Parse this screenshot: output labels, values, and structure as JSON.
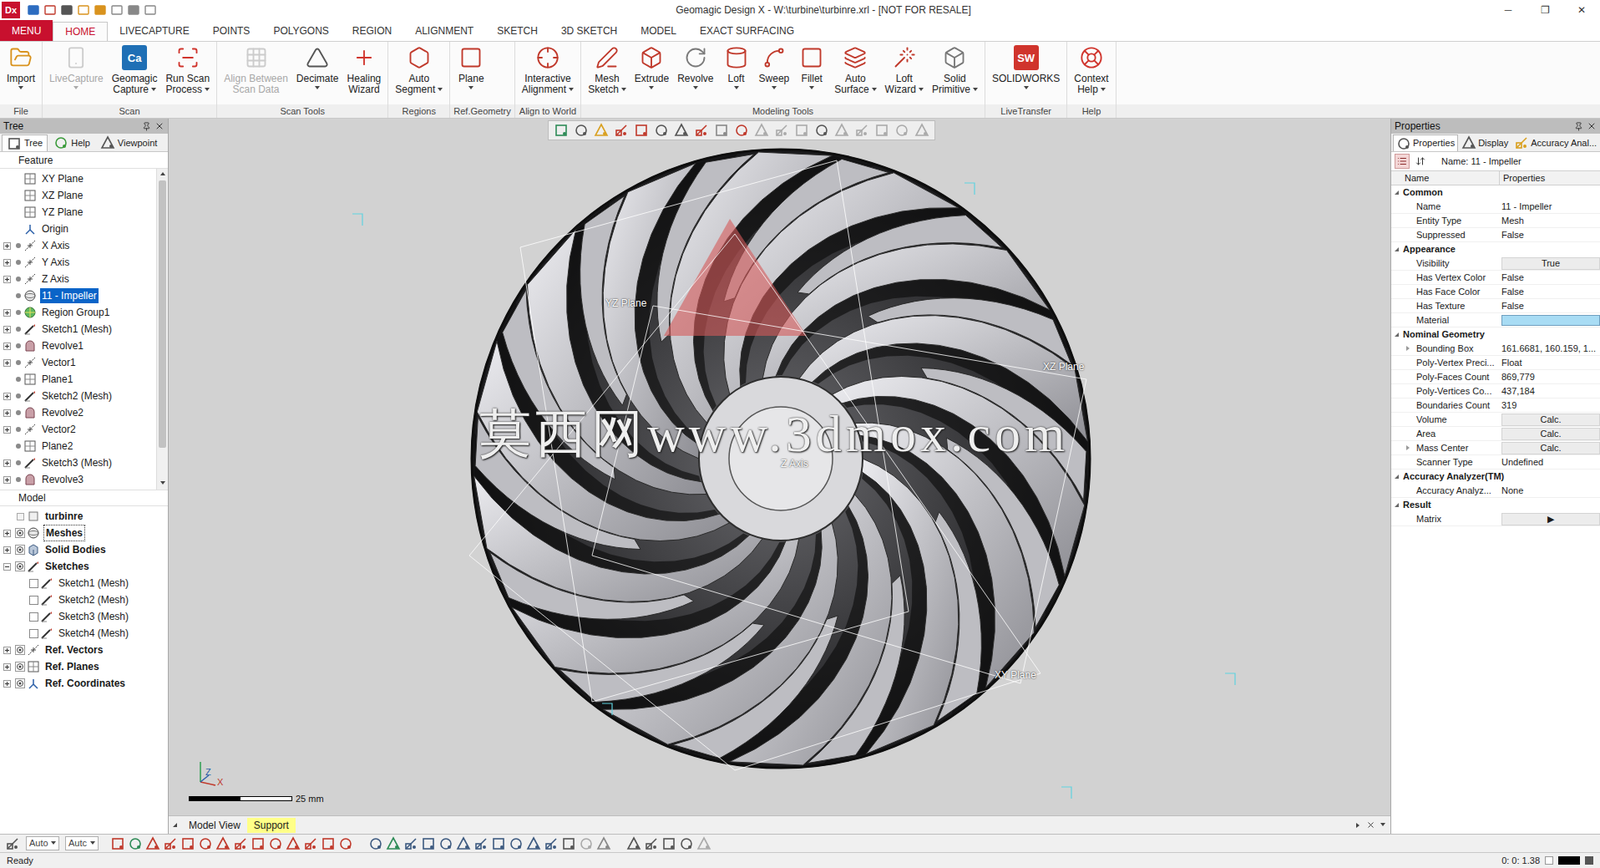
{
  "window": {
    "app_logo": "Dx",
    "title": "Geomagic Design X - W:\\turbine\\turbinre.xrl - [NOT FOR RESALE]",
    "controls": [
      "─",
      "❐",
      "✕"
    ]
  },
  "ribbon_tabs": [
    {
      "label": "MENU",
      "selected": false,
      "kind": "menu"
    },
    {
      "label": "HOME",
      "selected": true,
      "kind": "tab"
    },
    {
      "label": "LIVECAPTURE",
      "selected": false,
      "kind": "tab"
    },
    {
      "label": "POINTS",
      "selected": false,
      "kind": "tab"
    },
    {
      "label": "POLYGONS",
      "selected": false,
      "kind": "tab"
    },
    {
      "label": "REGION",
      "selected": false,
      "kind": "tab"
    },
    {
      "label": "ALIGNMENT",
      "selected": false,
      "kind": "tab"
    },
    {
      "label": "SKETCH",
      "selected": false,
      "kind": "tab"
    },
    {
      "label": "3D SKETCH",
      "selected": false,
      "kind": "tab"
    },
    {
      "label": "MODEL",
      "selected": false,
      "kind": "tab"
    },
    {
      "label": "EXACT SURFACING",
      "selected": false,
      "kind": "tab"
    }
  ],
  "ribbon_groups": [
    {
      "label": "File",
      "buttons": [
        {
          "lines": [
            "Import"
          ],
          "dropdown": true,
          "disabled": false
        }
      ]
    },
    {
      "label": "Scan",
      "buttons": [
        {
          "lines": [
            "LiveCapture"
          ],
          "dropdown": true,
          "disabled": true
        },
        {
          "lines": [
            "Geomagic",
            "Capture"
          ],
          "dropdown": true,
          "disabled": false,
          "logo": "Ca"
        },
        {
          "lines": [
            "Run Scan",
            "Process"
          ],
          "dropdown": true,
          "disabled": false
        }
      ]
    },
    {
      "label": "Scan Tools",
      "buttons": [
        {
          "lines": [
            "Align Between",
            "Scan Data"
          ],
          "dropdown": false,
          "disabled": true
        },
        {
          "lines": [
            "Decimate"
          ],
          "dropdown": true,
          "disabled": false
        },
        {
          "lines": [
            "Healing",
            "Wizard"
          ],
          "dropdown": false,
          "disabled": false
        }
      ]
    },
    {
      "label": "Regions",
      "buttons": [
        {
          "lines": [
            "Auto",
            "Segment"
          ],
          "dropdown": true,
          "disabled": false
        }
      ]
    },
    {
      "label": "Ref.Geometry",
      "buttons": [
        {
          "lines": [
            "Plane"
          ],
          "dropdown": true,
          "disabled": false
        }
      ]
    },
    {
      "label": "Align to World",
      "buttons": [
        {
          "lines": [
            "Interactive",
            "Alignment"
          ],
          "dropdown": true,
          "disabled": false
        }
      ]
    },
    {
      "label": "Modeling Tools",
      "buttons": [
        {
          "lines": [
            "Mesh",
            "Sketch"
          ],
          "dropdown": true,
          "disabled": false
        },
        {
          "lines": [
            "Extrude"
          ],
          "dropdown": true,
          "disabled": false
        },
        {
          "lines": [
            "Revolve"
          ],
          "dropdown": true,
          "disabled": false
        },
        {
          "lines": [
            "Loft"
          ],
          "dropdown": true,
          "disabled": false
        },
        {
          "lines": [
            "Sweep"
          ],
          "dropdown": true,
          "disabled": false
        },
        {
          "lines": [
            "Fillet"
          ],
          "dropdown": true,
          "disabled": false
        },
        {
          "lines": [
            "Auto",
            "Surface"
          ],
          "dropdown": true,
          "disabled": false
        },
        {
          "lines": [
            "Loft",
            "Wizard"
          ],
          "dropdown": true,
          "disabled": false
        },
        {
          "lines": [
            "Solid",
            "Primitive"
          ],
          "dropdown": true,
          "disabled": false
        }
      ]
    },
    {
      "label": "LiveTransfer",
      "buttons": [
        {
          "lines": [
            "SOLIDWORKS"
          ],
          "dropdown": true,
          "disabled": false,
          "logo": "SW"
        }
      ]
    },
    {
      "label": "Help",
      "buttons": [
        {
          "lines": [
            "Context",
            "Help"
          ],
          "dropdown": true,
          "disabled": false
        }
      ]
    }
  ],
  "tree_panel": {
    "title": "Tree",
    "tabs": [
      {
        "label": "Tree",
        "selected": true
      },
      {
        "label": "Help",
        "selected": false
      },
      {
        "label": "Viewpoint",
        "selected": false
      }
    ],
    "feature_label": "Feature",
    "scroll_level": 0.9,
    "features": [
      {
        "label": "XY Plane",
        "kind": "plane",
        "expandable": false,
        "expanded": false,
        "dot": false,
        "selected": false
      },
      {
        "label": "XZ Plane",
        "kind": "plane",
        "expandable": false,
        "expanded": false,
        "dot": false,
        "selected": false
      },
      {
        "label": "YZ Plane",
        "kind": "plane",
        "expandable": false,
        "expanded": false,
        "dot": false,
        "selected": false
      },
      {
        "label": "Origin",
        "kind": "origin",
        "expandable": false,
        "expanded": false,
        "dot": false,
        "selected": false
      },
      {
        "label": "X Axis",
        "kind": "axis",
        "expandable": true,
        "expanded": false,
        "dot": true,
        "selected": false
      },
      {
        "label": "Y Axis",
        "kind": "axis",
        "expandable": true,
        "expanded": false,
        "dot": true,
        "selected": false
      },
      {
        "label": "Z Axis",
        "kind": "axis",
        "expandable": true,
        "expanded": false,
        "dot": true,
        "selected": false
      },
      {
        "label": "11 - Impeller",
        "kind": "mesh",
        "expandable": false,
        "expanded": false,
        "dot": true,
        "selected": true
      },
      {
        "label": "Region Group1",
        "kind": "region",
        "expandable": true,
        "expanded": false,
        "dot": true,
        "selected": false
      },
      {
        "label": "Sketch1 (Mesh)",
        "kind": "sketch",
        "expandable": true,
        "expanded": false,
        "dot": true,
        "selected": false
      },
      {
        "label": "Revolve1",
        "kind": "revolve",
        "expandable": true,
        "expanded": false,
        "dot": true,
        "selected": false
      },
      {
        "label": "Vector1",
        "kind": "axis",
        "expandable": true,
        "expanded": false,
        "dot": true,
        "selected": false
      },
      {
        "label": "Plane1",
        "kind": "plane",
        "expandable": false,
        "expanded": false,
        "dot": true,
        "selected": false
      },
      {
        "label": "Sketch2 (Mesh)",
        "kind": "sketch",
        "expandable": true,
        "expanded": false,
        "dot": true,
        "selected": false
      },
      {
        "label": "Revolve2",
        "kind": "revolve",
        "expandable": true,
        "expanded": false,
        "dot": true,
        "selected": false
      },
      {
        "label": "Vector2",
        "kind": "axis",
        "expandable": true,
        "expanded": false,
        "dot": true,
        "selected": false
      },
      {
        "label": "Plane2",
        "kind": "plane",
        "expandable": false,
        "expanded": false,
        "dot": true,
        "selected": false
      },
      {
        "label": "Sketch3 (Mesh)",
        "kind": "sketch",
        "expandable": true,
        "expanded": false,
        "dot": true,
        "selected": false
      },
      {
        "label": "Revolve3",
        "kind": "revolve",
        "expandable": true,
        "expanded": false,
        "dot": true,
        "selected": false
      }
    ],
    "model_label": "Model",
    "model": [
      {
        "label": "turbinre",
        "kind": "root",
        "depth": 0,
        "expandable": false,
        "expanded": false,
        "control": "none",
        "checked": false,
        "bold": true,
        "focused": false
      },
      {
        "label": "Meshes",
        "kind": "mesh",
        "depth": 0,
        "expandable": true,
        "expanded": false,
        "control": "eye",
        "checked": true,
        "bold": true,
        "focused": true
      },
      {
        "label": "Solid Bodies",
        "kind": "solid",
        "depth": 0,
        "expandable": true,
        "expanded": false,
        "control": "eye",
        "checked": true,
        "bold": true,
        "focused": false
      },
      {
        "label": "Sketches",
        "kind": "sketch",
        "depth": 0,
        "expandable": true,
        "expanded": true,
        "control": "eye",
        "checked": true,
        "bold": true,
        "focused": false
      },
      {
        "label": "Sketch1 (Mesh)",
        "kind": "sketch",
        "depth": 1,
        "expandable": false,
        "expanded": false,
        "control": "checkbox",
        "checked": false,
        "bold": false,
        "focused": false
      },
      {
        "label": "Sketch2 (Mesh)",
        "kind": "sketch",
        "depth": 1,
        "expandable": false,
        "expanded": false,
        "control": "checkbox",
        "checked": false,
        "bold": false,
        "focused": false
      },
      {
        "label": "Sketch3 (Mesh)",
        "kind": "sketch",
        "depth": 1,
        "expandable": false,
        "expanded": false,
        "control": "checkbox",
        "checked": false,
        "bold": false,
        "focused": false
      },
      {
        "label": "Sketch4 (Mesh)",
        "kind": "sketch",
        "depth": 1,
        "expandable": false,
        "expanded": false,
        "control": "checkbox",
        "checked": false,
        "bold": false,
        "focused": false
      },
      {
        "label": "Ref. Vectors",
        "kind": "axis",
        "depth": 0,
        "expandable": true,
        "expanded": false,
        "control": "eye",
        "checked": true,
        "bold": true,
        "focused": false
      },
      {
        "label": "Ref. Planes",
        "kind": "plane",
        "depth": 0,
        "expandable": true,
        "expanded": false,
        "control": "eye",
        "checked": true,
        "bold": true,
        "focused": false
      },
      {
        "label": "Ref. Coordinates",
        "kind": "origin",
        "depth": 0,
        "expandable": true,
        "expanded": false,
        "control": "eye",
        "checked": true,
        "bold": true,
        "focused": false
      }
    ]
  },
  "viewport": {
    "labels": [
      "YZ Plane",
      "XZ Plane",
      "XY Plane",
      "Z Axis"
    ],
    "watermark": "莫西网www.3dmox.com",
    "scale": "25 mm",
    "triad": [
      "Z",
      "X"
    ]
  },
  "view_tabs": [
    {
      "label": "Model View",
      "selected": false
    },
    {
      "label": "Support",
      "selected": true
    }
  ],
  "properties_panel": {
    "title": "Properties",
    "tabs": [
      {
        "label": "Properties",
        "selected": true
      },
      {
        "label": "Display",
        "selected": false
      },
      {
        "label": "Accuracy Anal...",
        "selected": false
      }
    ],
    "name_line": "Name: 11 - Impeller",
    "columns": [
      "Name",
      "Properties"
    ],
    "sections": [
      {
        "label": "Common",
        "expanded": true,
        "rows": [
          {
            "name": "Name",
            "value": "11 - Impeller",
            "kind": "text",
            "expandable": false
          },
          {
            "name": "Entity Type",
            "value": "Mesh",
            "kind": "text",
            "expandable": false
          },
          {
            "name": "Suppressed",
            "value": "False",
            "kind": "text",
            "expandable": false
          }
        ]
      },
      {
        "label": "Appearance",
        "expanded": true,
        "rows": [
          {
            "name": "Visibility",
            "value": "True",
            "kind": "button",
            "expandable": false
          },
          {
            "name": "Has Vertex Color",
            "value": "False",
            "kind": "text",
            "expandable": false
          },
          {
            "name": "Has Face Color",
            "value": "False",
            "kind": "text",
            "expandable": false
          },
          {
            "name": "Has Texture",
            "value": "False",
            "kind": "text",
            "expandable": false
          },
          {
            "name": "Material",
            "value": "",
            "kind": "swatch",
            "color": "#a8dcf4",
            "expandable": false
          }
        ]
      },
      {
        "label": "Nominal Geometry",
        "expanded": true,
        "rows": [
          {
            "name": "Bounding Box",
            "value": "161.6681, 160.159, 1...",
            "kind": "text",
            "expandable": true
          },
          {
            "name": "Poly-Vertex Preci...",
            "value": "Float",
            "kind": "text",
            "expandable": false
          },
          {
            "name": "Poly-Faces Count",
            "value": "869,779",
            "kind": "text",
            "expandable": false
          },
          {
            "name": "Poly-Vertices Co...",
            "value": "437,184",
            "kind": "text",
            "expandable": false
          },
          {
            "name": "Boundaries Count",
            "value": "319",
            "kind": "text",
            "expandable": false
          },
          {
            "name": "Volume",
            "value": "Calc.",
            "kind": "button",
            "expandable": false
          },
          {
            "name": "Area",
            "value": "Calc.",
            "kind": "button",
            "expandable": false
          },
          {
            "name": "Mass Center",
            "value": "Calc.",
            "kind": "button",
            "expandable": true
          },
          {
            "name": "Scanner Type",
            "value": "Undefined",
            "kind": "text",
            "expandable": false
          }
        ]
      },
      {
        "label": "Accuracy Analyzer(TM)",
        "expanded": true,
        "rows": [
          {
            "name": "Accuracy Analyz...",
            "value": "None",
            "kind": "text",
            "expandable": false
          }
        ]
      },
      {
        "label": "Result",
        "expanded": true,
        "rows": [
          {
            "name": "Matrix",
            "value": "▶",
            "kind": "button",
            "expandable": false
          }
        ]
      }
    ]
  },
  "bottom_toolbar": {
    "selects": [
      "Auto",
      "Autc"
    ]
  },
  "status_bar": {
    "text": "Ready",
    "time": "0: 0: 1.38"
  }
}
